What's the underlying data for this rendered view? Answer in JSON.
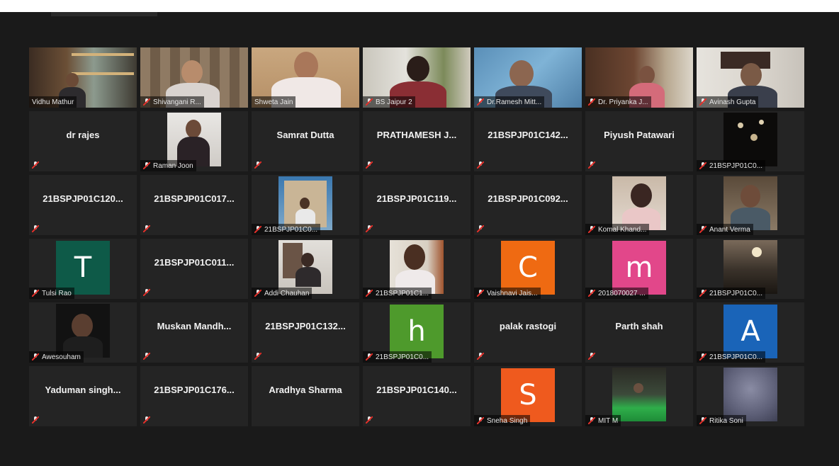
{
  "meeting": {
    "icons": {
      "muted": "muted-mic-icon"
    },
    "colors": {
      "active_speaker_border": "#c6d84a",
      "tile_bg": "#242424",
      "window_bg": "#1a1a1a"
    }
  },
  "participants": [
    {
      "name": "Vidhu Mathur",
      "kind": "video"
    },
    {
      "name": "Shivangani R...",
      "kind": "video"
    },
    {
      "name": "Shweta Jain",
      "kind": "video",
      "active": true
    },
    {
      "name": "BS Jaipur 2",
      "kind": "video"
    },
    {
      "name": "Dr.Ramesh Mitt...",
      "kind": "video"
    },
    {
      "name": "Dr. Priyanka J...",
      "kind": "video"
    },
    {
      "name": "Avinash Gupta",
      "kind": "video"
    },
    {
      "name": "dr rajes",
      "kind": "text"
    },
    {
      "name": "Raman Joon",
      "kind": "thumb"
    },
    {
      "name": "Samrat Dutta",
      "kind": "text"
    },
    {
      "name": "PRATHAMESH J...",
      "kind": "text"
    },
    {
      "name": "21BSPJP01C142...",
      "kind": "text"
    },
    {
      "name": "Piyush Patawari",
      "kind": "text"
    },
    {
      "name": "21BSPJP01C0...",
      "kind": "thumb"
    },
    {
      "name": "21BSPJP01C120...",
      "kind": "text"
    },
    {
      "name": "21BSPJP01C017...",
      "kind": "text"
    },
    {
      "name": "21BSPJP01C0...",
      "kind": "thumb"
    },
    {
      "name": "21BSPJP01C119...",
      "kind": "text"
    },
    {
      "name": "21BSPJP01C092...",
      "kind": "text"
    },
    {
      "name": "Komal Khand...",
      "kind": "thumb"
    },
    {
      "name": "Anant Verma",
      "kind": "thumb"
    },
    {
      "name": "Tulsi Rao",
      "kind": "letter",
      "letter": "T",
      "color": "#0e5a48"
    },
    {
      "name": "21BSPJP01C011...",
      "kind": "text"
    },
    {
      "name": "Addi Chauhan",
      "kind": "thumb"
    },
    {
      "name": "21BSPJP01C1...",
      "kind": "thumb"
    },
    {
      "name": "Vaishnavi Jais...",
      "kind": "letter",
      "letter": "C",
      "color": "#ef6a12"
    },
    {
      "name": "2018070027 ...",
      "kind": "letter",
      "letter": "m",
      "color": "#e2478a"
    },
    {
      "name": "21BSPJP01C0...",
      "kind": "thumb"
    },
    {
      "name": "Awesouham",
      "kind": "thumb"
    },
    {
      "name": "Muskan  Mandh...",
      "kind": "text"
    },
    {
      "name": "21BSPJP01C132...",
      "kind": "text"
    },
    {
      "name": "21BSPJP01C0...",
      "kind": "letter",
      "letter": "h",
      "color": "#4e9a2c"
    },
    {
      "name": "palak rastogi",
      "kind": "text"
    },
    {
      "name": "Parth shah",
      "kind": "text"
    },
    {
      "name": "21BSPJP01C0...",
      "kind": "letter",
      "letter": "A",
      "color": "#1a64b8"
    },
    {
      "name": "Yaduman  singh...",
      "kind": "text"
    },
    {
      "name": "21BSPJP01C176...",
      "kind": "text"
    },
    {
      "name": "Aradhya Sharma",
      "kind": "text"
    },
    {
      "name": "21BSPJP01C140...",
      "kind": "text"
    },
    {
      "name": "Sneha Singh",
      "kind": "letter",
      "letter": "S",
      "color": "#ef5a1e"
    },
    {
      "name": "MIT M",
      "kind": "thumb"
    },
    {
      "name": "Ritika Soni",
      "kind": "thumb"
    }
  ]
}
